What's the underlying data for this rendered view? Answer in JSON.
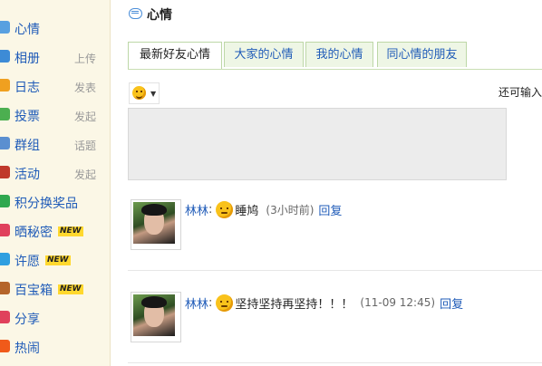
{
  "sidebar": {
    "items": [
      {
        "label": "心情",
        "sub": "",
        "badge": "",
        "icon": "chat-bubble-icon",
        "color": "#58a0e0"
      },
      {
        "label": "相册",
        "sub": "上传",
        "badge": "",
        "icon": "photo-album-icon",
        "color": "#3d8bd6"
      },
      {
        "label": "日志",
        "sub": "发表",
        "badge": "",
        "icon": "journal-icon",
        "color": "#f0a020"
      },
      {
        "label": "投票",
        "sub": "发起",
        "badge": "",
        "icon": "vote-chart-icon",
        "color": "#4caf50"
      },
      {
        "label": "群组",
        "sub": "话题",
        "badge": "",
        "icon": "group-icon",
        "color": "#5b8fd0"
      },
      {
        "label": "活动",
        "sub": "发起",
        "badge": "",
        "icon": "calendar-icon",
        "color": "#c0392b"
      },
      {
        "label": "积分换奖品",
        "sub": "",
        "badge": "",
        "icon": "gift-icon",
        "color": "#2fa84f"
      },
      {
        "label": "晒秘密",
        "sub": "",
        "badge": "NEW",
        "icon": "heart-secret-icon",
        "color": "#e0415c"
      },
      {
        "label": "许愿",
        "sub": "",
        "badge": "NEW",
        "icon": "star-wish-icon",
        "color": "#2f9fe0"
      },
      {
        "label": "百宝箱",
        "sub": "",
        "badge": "NEW",
        "icon": "treasure-chest-icon",
        "color": "#b5652a"
      },
      {
        "label": "分享",
        "sub": "",
        "badge": "",
        "icon": "share-heart-icon",
        "color": "#e0415c"
      },
      {
        "label": "热闹",
        "sub": "",
        "badge": "",
        "icon": "fire-icon",
        "color": "#f05a1a"
      }
    ]
  },
  "main": {
    "title": "心情",
    "tabs": [
      "最新好友心情",
      "大家的心情",
      "我的心情",
      "同心情的朋友"
    ],
    "remain_text": "还可输入",
    "posts": [
      {
        "user": "林林",
        "text": "睡鸠",
        "time": "(3小时前)",
        "reply": "回复"
      },
      {
        "user": "林林",
        "text": "坚持坚持再坚持！！！",
        "time": "(11-09 12:45)",
        "reply": "回复"
      }
    ]
  }
}
